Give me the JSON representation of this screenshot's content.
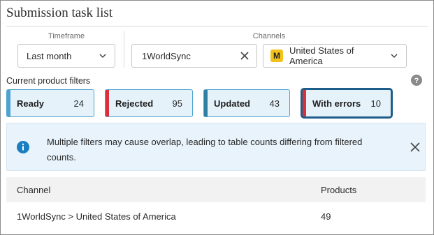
{
  "page": {
    "title": "Submission task list"
  },
  "timeframe": {
    "label": "Timeframe",
    "value": "Last month"
  },
  "channels": {
    "label": "Channels",
    "search_value": "1WorldSync",
    "market_badge": "M",
    "market_value": "United States of America"
  },
  "filters": {
    "label": "Current product filters",
    "chips": [
      {
        "label": "Ready",
        "count": "24",
        "color": "#4da3cf",
        "selected": false
      },
      {
        "label": "Rejected",
        "count": "95",
        "color": "#d9303c",
        "selected": false
      },
      {
        "label": "Updated",
        "count": "43",
        "color": "#2f7fa3",
        "selected": false
      },
      {
        "label": "With errors",
        "count": "10",
        "color": "#d9303c",
        "selected": true
      }
    ]
  },
  "banner": {
    "message": "Multiple filters may cause overlap, leading to table counts differing from filtered counts."
  },
  "table": {
    "headers": {
      "channel": "Channel",
      "products": "Products"
    },
    "rows": [
      {
        "channel": "1WorldSync > United States of America",
        "products": "49"
      }
    ]
  }
}
